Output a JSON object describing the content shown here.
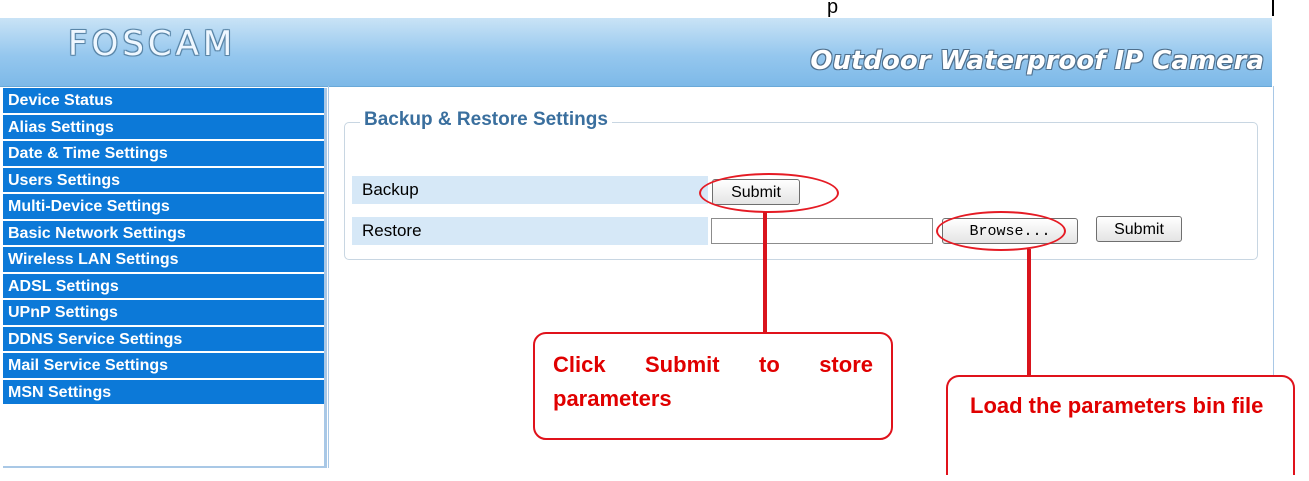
{
  "top_glyph": "p",
  "header": {
    "logo": "FOSCAM",
    "tagline": "Outdoor Waterproof IP Camera"
  },
  "sidebar": {
    "items": [
      {
        "label": "Device Status"
      },
      {
        "label": "Alias Settings"
      },
      {
        "label": "Date & Time Settings"
      },
      {
        "label": "Users Settings"
      },
      {
        "label": "Multi-Device Settings"
      },
      {
        "label": "Basic Network Settings"
      },
      {
        "label": "Wireless LAN Settings"
      },
      {
        "label": "ADSL Settings"
      },
      {
        "label": "UPnP Settings"
      },
      {
        "label": "DDNS Service Settings"
      },
      {
        "label": "Mail Service Settings"
      },
      {
        "label": "MSN Settings"
      }
    ]
  },
  "main": {
    "section_title": "Backup & Restore Settings",
    "backup": {
      "label": "Backup",
      "submit_label": "Submit"
    },
    "restore": {
      "label": "Restore",
      "file_value": "",
      "browse_label": "Browse...",
      "submit_label": "Submit"
    }
  },
  "annotations": {
    "callout_submit": "Click Submit to store parameters",
    "callout_load": "Load the parameters bin file",
    "color": "#e0121b"
  }
}
